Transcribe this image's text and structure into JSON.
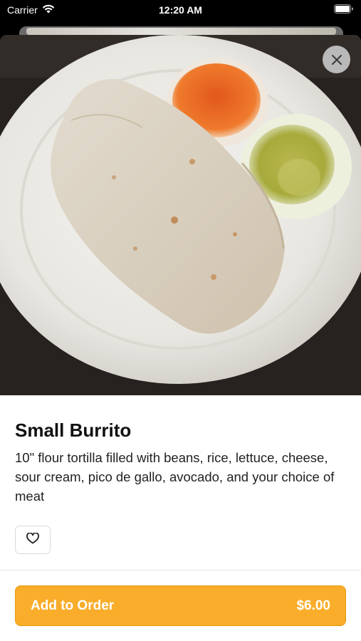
{
  "status_bar": {
    "carrier": "Carrier",
    "time": "12:20 AM"
  },
  "item": {
    "title": "Small Burrito",
    "description": "10\" flour tortilla filled with beans, rice, lettuce, cheese, sour cream, pico de gallo, avocado, and your choice of meat",
    "image_subject": "burrito on paper plate with red and green salsa cups"
  },
  "actions": {
    "add_label": "Add to Order",
    "price": "$6.00"
  },
  "icons": {
    "close": "close-icon",
    "favorite": "heart-icon",
    "wifi": "wifi-icon",
    "battery": "battery-icon"
  },
  "colors": {
    "accent": "#f9ad2a",
    "accent_border": "#e79a10",
    "text_primary": "#111111"
  }
}
